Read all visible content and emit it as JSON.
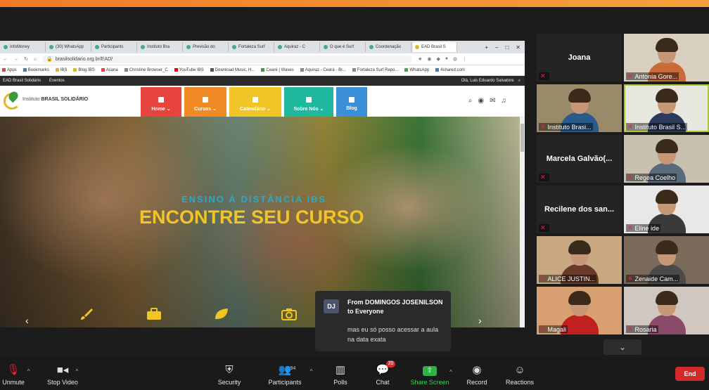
{
  "browser": {
    "tabs": [
      "InfoMoney",
      "(30) WhatsApp",
      "Participants",
      "Instituto Bra",
      "Previsão do",
      "Fortaleza Surf",
      "Aquiraz - C",
      "O que é Surf",
      "Coordenação",
      "EAD Brasil S"
    ],
    "url": "brasilsolidario.org.br/EAD/",
    "bookmarks": [
      "Apps",
      "Bookmarks",
      "IBS",
      "Blog IBS",
      "Asana",
      "Christine Browser_C",
      "YouTube IBS",
      "Download Music, H...",
      "Cearé | Waves",
      "Aquiraz - Ceará - Br...",
      "Fortaleza Surf Repo...",
      "WhatsApp",
      "4shared.com"
    ]
  },
  "site": {
    "bar_left": "EAD Brasil Solidário",
    "bar_events": "Eventos",
    "bar_user": "Olá, Luis Eduardo Salvatore",
    "logo_brand": "Instituto",
    "logo_name": "BRASIL SOLIDÁRIO",
    "menu": [
      {
        "label": "Home ⌄",
        "color": "#e8443e"
      },
      {
        "label": "Cursos ⌄",
        "color": "#f08a24"
      },
      {
        "label": "Calendário ⌄",
        "color": "#f2c526"
      },
      {
        "label": "Sobre Nós ⌄",
        "color": "#1fb89c"
      },
      {
        "label": "Blog",
        "color": "#3b8ed8"
      }
    ],
    "hero_subtitle": "ENSINO À DISTÂNCIA IBS",
    "hero_title": "ENCONTRE SEU CURSO",
    "feature_icons": [
      "brush-icon",
      "briefcase-icon",
      "leaf-icon",
      "camera-icon"
    ]
  },
  "chat_popup": {
    "initials": "DJ",
    "from": "From DOMINGOS JOSENILSON to Everyone",
    "message": "mas eu só posso acessar a aula na data exata"
  },
  "participants": [
    {
      "name": "Joana",
      "label": "",
      "video": false
    },
    {
      "name": "",
      "label": "Antonia Gore...",
      "video": true,
      "bg": "#d8cfc0",
      "shirt": "#c96a3a"
    },
    {
      "name": "",
      "label": "Instituto Brasi...",
      "video": true,
      "bg": "#9a8a6a",
      "shirt": "#2a5a8a"
    },
    {
      "name": "",
      "label": "Instituto Brasil S...",
      "video": true,
      "bg": "#e8e8e0",
      "shirt": "#2a3a5a"
    },
    {
      "name": "Marcela Galvão(...",
      "label": "",
      "video": false
    },
    {
      "name": "",
      "label": "Regea Coelho",
      "video": true,
      "bg": "#c8c0b0",
      "shirt": "#5a6a7a"
    },
    {
      "name": "Recilene dos san...",
      "label": "",
      "video": false
    },
    {
      "name": "",
      "label": "Eline ide",
      "video": true,
      "bg": "#e8e8e8",
      "shirt": "#3a3a3a"
    },
    {
      "name": "",
      "label": "ALICE JUSTIN...",
      "video": true,
      "bg": "#c8a880",
      "shirt": "#6a3a2a"
    },
    {
      "name": "",
      "label": "Zenaide Cam...",
      "video": true,
      "bg": "#7a6a5a",
      "shirt": "#4a4a4a"
    },
    {
      "name": "",
      "label": "Magali",
      "video": true,
      "bg": "#d8a070",
      "shirt": "#c02020"
    },
    {
      "name": "",
      "label": "Rosaria",
      "video": true,
      "bg": "#d0c8c0",
      "shirt": "#8a4a6a"
    }
  ],
  "toolbar": {
    "unmute": "Unmute",
    "stop_video": "Stop Video",
    "security": "Security",
    "participants": "Participants",
    "participants_count": "94",
    "polls": "Polls",
    "chat": "Chat",
    "chat_badge": "20",
    "share_screen": "Share Screen",
    "record": "Record",
    "reactions": "Reactions",
    "end": "End"
  }
}
